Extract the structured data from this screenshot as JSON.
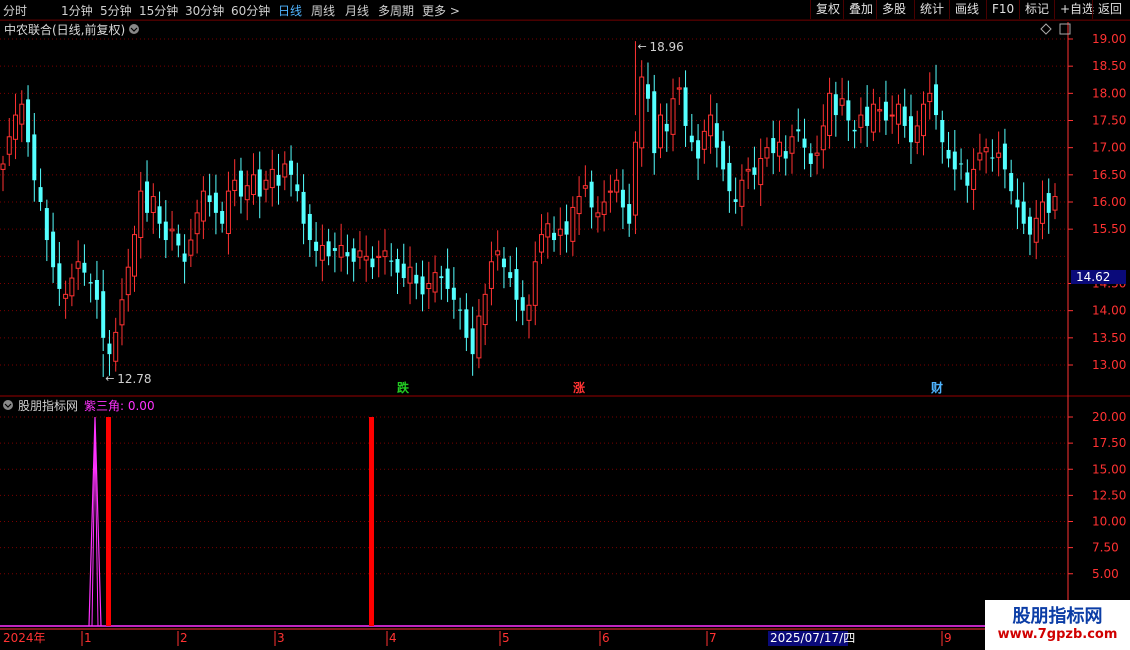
{
  "toolbar": {
    "periods": [
      "分时",
      "1分钟",
      "5分钟",
      "15分钟",
      "30分钟",
      "60分钟",
      "日线",
      "周线",
      "月线",
      "多周期",
      "更多 >"
    ],
    "active_period": "日线",
    "buttons": [
      "复权",
      "叠加",
      "多股",
      "统计",
      "画线",
      "F10",
      "标记",
      "+自选",
      "返回"
    ]
  },
  "price_panel": {
    "title": "中农联合(日线,前复权)",
    "price_ticks": [
      "19.00",
      "18.50",
      "18.00",
      "17.50",
      "17.00",
      "16.50",
      "16.00",
      "15.50",
      "14.50",
      "14.00",
      "13.50",
      "13.00"
    ],
    "current_price": "14.62",
    "high_label": "18.96",
    "low_label": "12.78",
    "markers": [
      {
        "text": "跌",
        "color": "#22cc22"
      },
      {
        "text": "涨",
        "color": "#ff3333"
      },
      {
        "text": "财",
        "color": "#4fb4ff"
      }
    ]
  },
  "indicator_panel": {
    "name": "股朋指标网",
    "series_label": "紫三角: 0.00",
    "ticks": [
      "20.00",
      "17.50",
      "15.00",
      "12.50",
      "10.00",
      "7.50",
      "5.00"
    ]
  },
  "date_axis": {
    "year_label": "2024年",
    "month_labels": [
      "1",
      "2",
      "3",
      "4",
      "5",
      "6",
      "7",
      "9"
    ],
    "cursor_date": "2025/07/17/四"
  },
  "watermark": {
    "line1": "股朋指标网",
    "line2": "www.7gpzb.com"
  },
  "colors": {
    "up": "#ff3232",
    "down": "#54ffff",
    "grid": "#7a0000",
    "axis": "#ff3232",
    "purple": "#ff33ff",
    "bar": "#ff0000"
  },
  "chart_data": {
    "type": "candlestick+bar",
    "price_range": [
      12.78,
      18.96
    ],
    "candle_closes": [
      16.7,
      17.2,
      17.6,
      17.8,
      17.1,
      16.4,
      16.0,
      15.3,
      14.8,
      14.4,
      14.3,
      14.6,
      14.9,
      14.7,
      14.5,
      14.2,
      13.5,
      13.2,
      13.6,
      14.2,
      14.8,
      15.4,
      16.2,
      15.8,
      16.1,
      15.6,
      15.3,
      15.5,
      15.2,
      14.9,
      15.3,
      15.8,
      16.2,
      16.0,
      15.8,
      15.6,
      16.2,
      16.4,
      16.1,
      16.3,
      16.5,
      16.1,
      16.4,
      16.6,
      16.3,
      16.7,
      16.5,
      16.2,
      15.6,
      15.3,
      15.1,
      15.2,
      15.0,
      15.1,
      15.2,
      15.0,
      14.9,
      15.1,
      15.0,
      14.8,
      15.0,
      15.1,
      14.9,
      14.7,
      14.6,
      14.8,
      14.5,
      14.3,
      14.5,
      14.7,
      14.6,
      14.4,
      14.2,
      14.0,
      13.5,
      13.2,
      13.9,
      14.3,
      14.9,
      15.1,
      14.8,
      14.6,
      14.2,
      14.0,
      14.1,
      14.9,
      15.4,
      15.6,
      15.3,
      15.5,
      15.4,
      15.9,
      16.1,
      16.3,
      15.9,
      15.8,
      16.0,
      16.2,
      16.4,
      15.9,
      15.6,
      17.1,
      18.3,
      17.9,
      16.9,
      17.6,
      17.3,
      17.9,
      18.1,
      17.4,
      17.1,
      16.8,
      17.3,
      17.6,
      17.0,
      16.6,
      16.2,
      16.0,
      16.4,
      16.6,
      16.5,
      16.8,
      17.0,
      16.9,
      17.1,
      16.8,
      17.2,
      17.3,
      17.0,
      16.7,
      16.9,
      17.4,
      18.0,
      17.6,
      17.9,
      17.5,
      17.3,
      17.6,
      17.4,
      17.8,
      17.7,
      17.5,
      17.6,
      17.8,
      17.4,
      17.1,
      17.4,
      17.8,
      18.0,
      17.6,
      17.1,
      16.8,
      16.6,
      16.7,
      16.3,
      16.6,
      16.9,
      17.0,
      16.8,
      16.9,
      16.6,
      16.2,
      15.9,
      15.6,
      15.4,
      15.7,
      16.0,
      15.8,
      16.1
    ],
    "indicator_bars": [
      {
        "date_index": 4,
        "value": 20.0,
        "color": "#ff0000"
      },
      {
        "date_index": 40,
        "value": 20.0,
        "color": "#ff0000"
      }
    ],
    "indicator_purple_spike": 20.0,
    "indicator_ylim": [
      0,
      20.0
    ]
  }
}
